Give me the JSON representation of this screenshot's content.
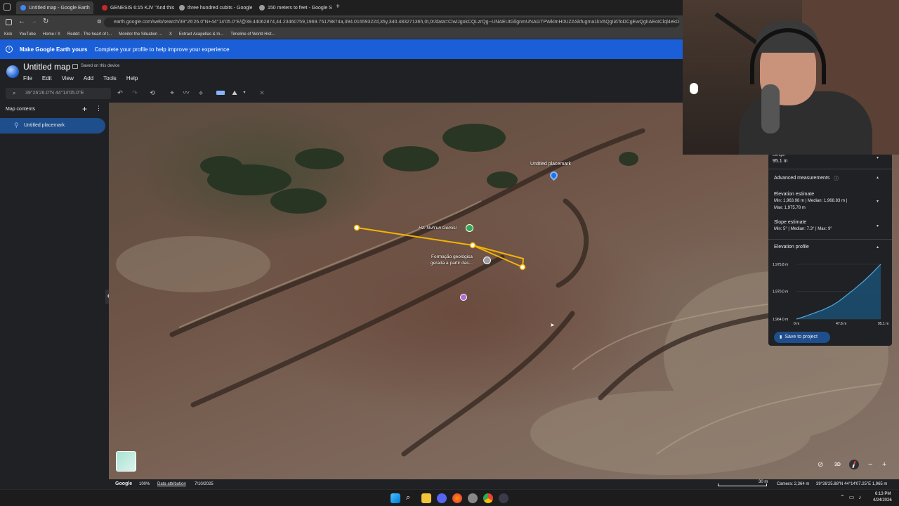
{
  "tabs": [
    {
      "title": "Untitled map - Google Earth",
      "active": true,
      "color": "#4285f4"
    },
    {
      "title": "GENESIS 6:15 KJV \"And this is t",
      "active": false,
      "color": "#c62828"
    },
    {
      "title": "three hundred cubits - Google",
      "active": false,
      "color": "#9e9e9e"
    },
    {
      "title": "150 meters to feet - Google Se",
      "active": false,
      "color": "#9e9e9e"
    }
  ],
  "new_tab": "+",
  "url": "earth.google.com/web/search/39°26'26.0\"N+44°14'05.0\"E/@39.44062874,44.23460759,1969.75179874a,394.01659322d,35y,340.48327136h,0t,0r/data=CiwiJgokCQLzrQg--UNAEUtGlignmUNAGTPWkimH0UZASkfugma1kVAQgIiAToDCgEwQgIIAEoIClql4ekDEAA",
  "bookmarks": [
    "Kick",
    "YouTube",
    "Home / X",
    "Reddit - The heart of t...",
    "Monitor the Situation ...",
    "X",
    "Extract Acapellas & In...",
    "Timeline of World Hist..."
  ],
  "banner": {
    "bold": "Make Google Earth yours",
    "text": "Complete your profile to help improve your experience"
  },
  "project": {
    "title": "Untitled map",
    "saved": "Saved on this device"
  },
  "menu": [
    "File",
    "Edit",
    "View",
    "Add",
    "Tools",
    "Help"
  ],
  "search": {
    "placeholder": "39°26'26.0\"N 44°14'05.0\"E"
  },
  "sidebar": {
    "title": "Map contents",
    "items": [
      {
        "label": "Untitled placemark",
        "selected": true
      }
    ]
  },
  "map_labels": {
    "placemark": "Untitled placemark",
    "poi1": "Hz. Nuh'un Gemisi",
    "poi2a": "Formação geológica",
    "poi2b": "gerada a partir das..."
  },
  "panel": {
    "length_label": "Length",
    "length_value": "95.1 m",
    "advanced": "Advanced measurements",
    "elevation_title": "Elevation estimate",
    "elevation_value": "Min: 1,963.98 m  |  Median: 1,968.83 m  |",
    "elevation_value2": "Max: 1,975.78 m",
    "slope_title": "Slope estimate",
    "slope_value": "Min: 5°  |  Median: 7.3°  |  Max: 9°",
    "profile_title": "Elevation profile",
    "save_button": "Save to project"
  },
  "chart_data": {
    "type": "area",
    "x": [
      0,
      10,
      20,
      30,
      40,
      47.6,
      55,
      65,
      75,
      85,
      95.1
    ],
    "y": [
      1964.0,
      1964.6,
      1965.3,
      1966.0,
      1966.9,
      1967.8,
      1968.9,
      1970.4,
      1972.0,
      1973.8,
      1975.8
    ],
    "xticks": [
      "0 m",
      "47.6 m",
      "95.1 m"
    ],
    "yticks": [
      "1,975.8 m",
      "1,970.0 m",
      "1,964.0 m"
    ],
    "xlim": [
      0,
      95.1
    ],
    "ylim": [
      1964.0,
      1975.8
    ],
    "color": "#4ea8de"
  },
  "bottom": {
    "google": "Google",
    "zoom": "100%",
    "attribution": "Data attribution",
    "date": "7/10/2025",
    "scale": "30 m",
    "camera": "Camera: 2,364 m",
    "coords": "39°26'25.88\"N 44°14'07.25\"E  1,965 m",
    "mode": "3D"
  },
  "clock": {
    "time": "6:13 PM",
    "date": "4/24/2026"
  },
  "colors": {
    "accent": "#1a5fd8",
    "selected": "#1f4e8c",
    "path": "#f5b400"
  }
}
